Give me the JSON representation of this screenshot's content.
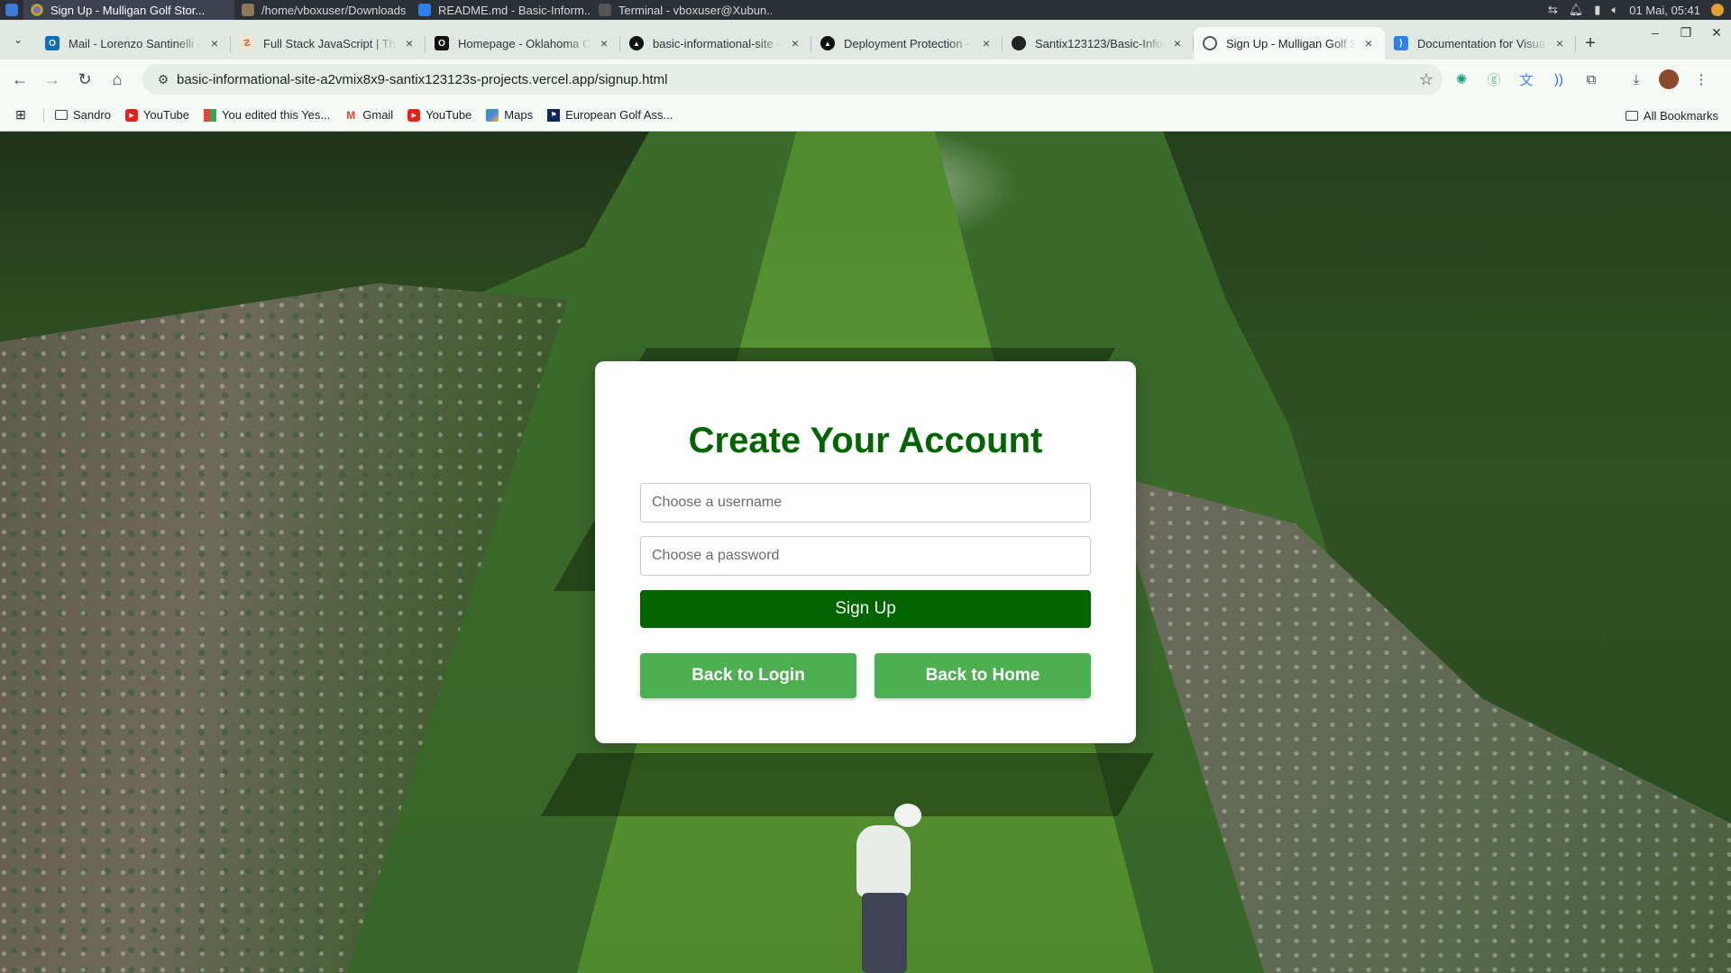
{
  "taskbar": {
    "items": [
      {
        "label": "Sign Up - Mulligan Golf Stor...",
        "color": "#4285f4"
      },
      {
        "label": "/home/vboxuser/Downloads",
        "color": "#8a7a5a"
      },
      {
        "label": "README.md - Basic-Inform...",
        "color": "#2f80ed"
      },
      {
        "label": "Terminal - vboxuser@Xubun...",
        "color": "#555"
      }
    ],
    "datetime": "01 Mai, 05:41"
  },
  "tabs": [
    {
      "label": "Mail - Lorenzo Santinelli -",
      "icon": "outlook-icon",
      "glyph": "O",
      "color": "#0f6cbd"
    },
    {
      "label": "Full Stack JavaScript | The",
      "icon": "odin-icon",
      "glyph": "☡",
      "color": "#e8a050"
    },
    {
      "label": "Homepage - Oklahoma C",
      "icon": "ouk-icon",
      "glyph": "O",
      "color": "#111"
    },
    {
      "label": "basic-informational-site -",
      "icon": "vercel-icon",
      "glyph": "▲",
      "color": "#111"
    },
    {
      "label": "Deployment Protection -",
      "icon": "vercel-icon",
      "glyph": "▲",
      "color": "#111"
    },
    {
      "label": "Santix123123/Basic-Infor",
      "icon": "github-icon",
      "glyph": "●",
      "color": "#222"
    },
    {
      "label": "Sign Up - Mulligan Golf S",
      "icon": "globe-icon",
      "glyph": "◍",
      "color": "#555",
      "active": true
    },
    {
      "label": "Documentation for Visua",
      "icon": "vscode-icon",
      "glyph": "⟩",
      "color": "#2f80ed"
    }
  ],
  "toolbar": {
    "url": "basic-informational-site-a2vmix8x9-santix123123s-projects.vercel.app/signup.html"
  },
  "bookmarks": {
    "items": [
      {
        "label": "Sandro",
        "icon": "folder-icon"
      },
      {
        "label": "YouTube",
        "icon": "youtube-icon"
      },
      {
        "label": "You edited this Yes...",
        "icon": "google-sheets-icon"
      },
      {
        "label": "Gmail",
        "icon": "gmail-icon"
      },
      {
        "label": "YouTube",
        "icon": "youtube-icon"
      },
      {
        "label": "Maps",
        "icon": "maps-icon"
      },
      {
        "label": "European Golf Ass...",
        "icon": "ega-icon"
      }
    ],
    "all_label": "All Bookmarks"
  },
  "signup": {
    "title": "Create Your Account",
    "username_placeholder": "Choose a username",
    "password_placeholder": "Choose a password",
    "signup_label": "Sign Up",
    "back_login_label": "Back to Login",
    "back_home_label": "Back to Home"
  },
  "colors": {
    "brand_green": "#006400",
    "secondary_green": "#4caf50"
  }
}
